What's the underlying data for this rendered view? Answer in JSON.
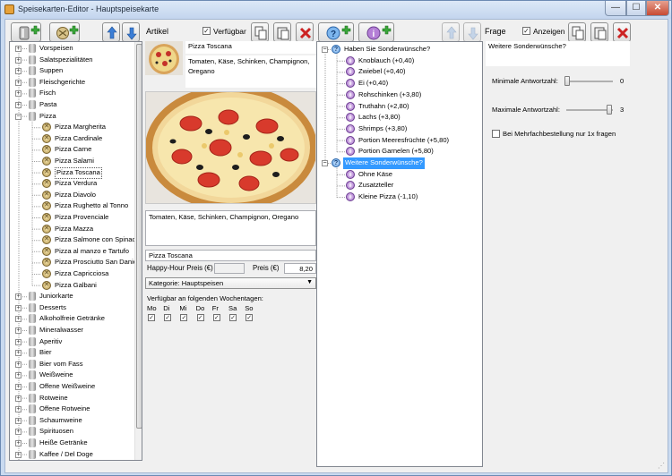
{
  "window": {
    "title": "Speisekarten-Editor - Hauptspeisekarte",
    "min_glyph": "—",
    "max_glyph": "☐",
    "close_glyph": "✕"
  },
  "toolbar_left": {
    "add_category_icon": "category-add-icon",
    "add_item_icon": "item-add-icon",
    "up_icon": "arrow-up-icon",
    "down_icon": "arrow-down-icon",
    "section_label": "Artikel",
    "available_label": "Verfügbar",
    "available_checked": true
  },
  "toolbar_right": {
    "add_question_icon": "question-add-icon",
    "add_answer_icon": "answer-add-icon",
    "section_label": "Frage",
    "show_label": "Anzeigen",
    "show_checked": true
  },
  "categories": [
    {
      "label": "Vorspeisen",
      "expanded": false
    },
    {
      "label": "Salatspezialitäten",
      "expanded": false
    },
    {
      "label": "Suppen",
      "expanded": false
    },
    {
      "label": "Fleischgerichte",
      "expanded": false
    },
    {
      "label": "Fisch",
      "expanded": false
    },
    {
      "label": "Pasta",
      "expanded": false
    },
    {
      "label": "Pizza",
      "expanded": true,
      "items": [
        "Pizza Margherita",
        "Pizza Cardinale",
        "Pizza Carne",
        "Pizza Salami",
        "Pizza Toscana",
        "Pizza Verdura",
        "Pizza Diavolo",
        "Pizza Rughetto al Tonno",
        "Pizza Provenciale",
        "Pizza Mazza",
        "Pizza Salmone con Spinach",
        "Pizza al manzo e Tartufo",
        "Pizza Prosciutto San Daniele",
        "Pizza Capricciosa",
        "Pizza Galbani"
      ],
      "selected_item": "Pizza Toscana"
    },
    {
      "label": "Juniorkarte",
      "expanded": false
    },
    {
      "label": "Desserts",
      "expanded": false
    },
    {
      "label": "Alkoholfreie Getränke",
      "expanded": false
    },
    {
      "label": "Mineralwasser",
      "expanded": false
    },
    {
      "label": "Aperitiv",
      "expanded": false
    },
    {
      "label": "Bier",
      "expanded": false
    },
    {
      "label": "Bier vom Fass",
      "expanded": false
    },
    {
      "label": "Weißweine",
      "expanded": false
    },
    {
      "label": "Offene Weißweine",
      "expanded": false
    },
    {
      "label": "Rotweine",
      "expanded": false
    },
    {
      "label": "Offene Rotweine",
      "expanded": false
    },
    {
      "label": "Schaumweine",
      "expanded": false
    },
    {
      "label": "Spirituosen",
      "expanded": false
    },
    {
      "label": "Heiße Getränke",
      "expanded": false
    },
    {
      "label": "Kaffee / Del Doge",
      "expanded": false
    }
  ],
  "article": {
    "name": "Pizza Toscana",
    "short_desc": "Tomaten, Käse, Schinken, Champignon, Oregano",
    "long_desc": "Tomaten, Käse, Schinken, Champignon, Oregano",
    "print_name": "Pizza Toscana",
    "happy_hour_label": "Happy-Hour Preis (€)",
    "happy_hour_value": "",
    "price_label": "Preis (€)",
    "price_value": "8,20",
    "category_select": "Kategorie: Hauptspeisen",
    "weekdays_label": "Verfügbar an folgenden Wochentagen:",
    "weekdays": [
      {
        "day": "Mo",
        "checked": true
      },
      {
        "day": "Di",
        "checked": true
      },
      {
        "day": "Mi",
        "checked": true
      },
      {
        "day": "Do",
        "checked": true
      },
      {
        "day": "Fr",
        "checked": true
      },
      {
        "day": "Sa",
        "checked": true
      },
      {
        "day": "So",
        "checked": true
      }
    ]
  },
  "questions": [
    {
      "label": "Haben Sie Sonderwünsche?",
      "selected": false,
      "answers": [
        "Knoblauch (+0,40)",
        "Zwiebel (+0,40)",
        "Ei (+0,40)",
        "Rohschinken (+3,80)",
        "Truthahn (+2,80)",
        "Lachs (+3,80)",
        "Shrimps (+3,80)",
        "Portion Meeresfrüchte (+5,80)",
        "Portion Garnelen (+5,80)"
      ]
    },
    {
      "label": "Weitere Sonderwünsche?",
      "selected": true,
      "answers": [
        "Ohne Käse",
        "Zusatzteller",
        "Kleine Pizza (-1,10)"
      ]
    }
  ],
  "question_props": {
    "text": "Weitere Sonderwünsche?",
    "min_label": "Minimale Antwortzahl:",
    "min_value": "0",
    "max_label": "Maximale Antwortzahl:",
    "max_value": "3",
    "multi_label": "Bei Mehrfachbestellung nur 1x fragen",
    "multi_checked": false
  },
  "colors": {
    "accent": "#3399ff",
    "delete": "#cc2222"
  }
}
